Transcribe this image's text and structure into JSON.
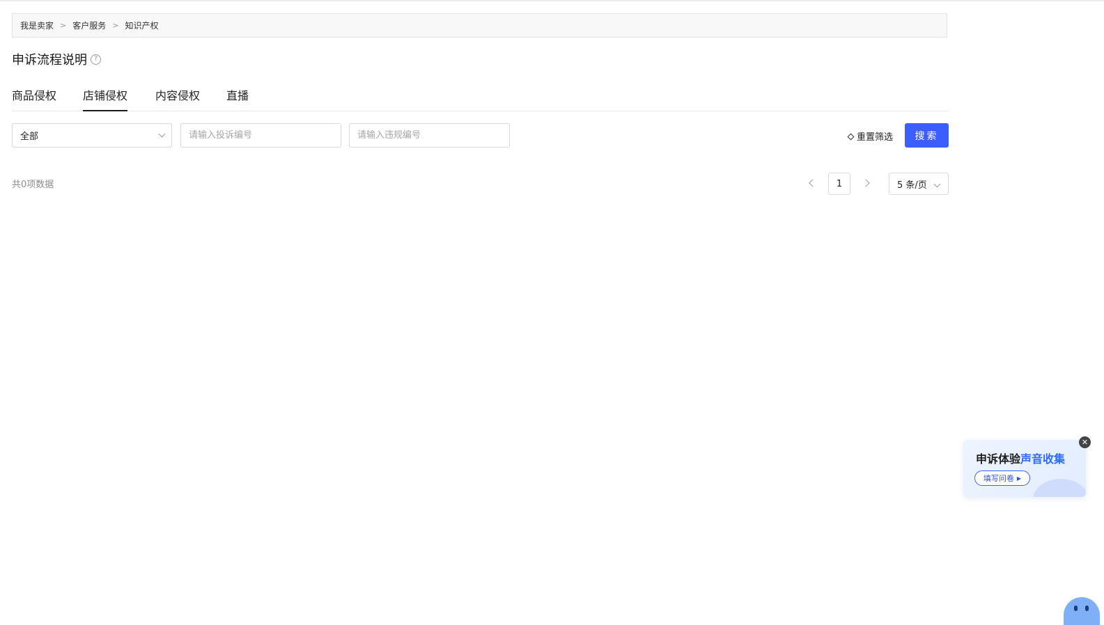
{
  "breadcrumb": {
    "items": [
      "我是卖家",
      "客户服务",
      "知识产权"
    ],
    "separator": ">"
  },
  "page": {
    "title": "申诉流程说明",
    "help_icon": "?"
  },
  "tabs": [
    {
      "label": "商品侵权",
      "active": false
    },
    {
      "label": "店铺侵权",
      "active": true
    },
    {
      "label": "内容侵权",
      "active": false
    },
    {
      "label": "直播",
      "active": false
    }
  ],
  "filters": {
    "status_select": {
      "value": "全部",
      "icon": "chevron-down-icon"
    },
    "complaint_input": {
      "value": "",
      "placeholder": "请输入投诉编号"
    },
    "violation_input": {
      "value": "",
      "placeholder": "请输入违规编号"
    },
    "reset_label": "重置筛选",
    "search_label": "搜索"
  },
  "results": {
    "total_text": "共0项数据"
  },
  "pagination": {
    "current_page": "1",
    "page_size": "5 条/页"
  },
  "survey_popup": {
    "title_plain": "申诉体验",
    "title_highlight": "声音收集",
    "button_label": "填写问卷",
    "button_icon": "▶",
    "close_icon": "✕"
  },
  "colors": {
    "accent": "#3d5eff",
    "highlight_text": "#2f6bff",
    "breadcrumb_bg": "#f8f8f8"
  }
}
